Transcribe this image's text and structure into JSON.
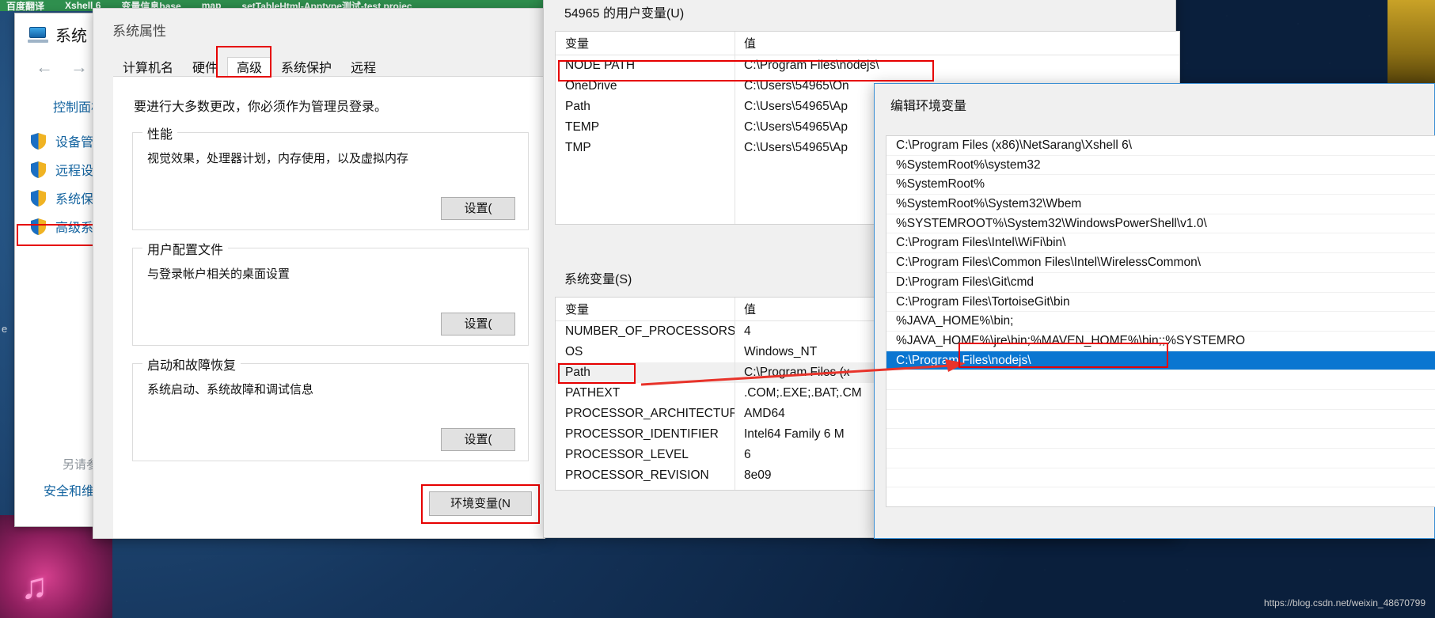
{
  "desktop": {
    "browser_tabs": [
      "百度翻译",
      "Xshell 6",
      "变量信息base",
      "map",
      "setTableHtml-Apptype测试-test projec"
    ],
    "stray_letter": "e"
  },
  "control_panel": {
    "title": "系统",
    "nav": {
      "back": "←",
      "forward": "→",
      "recent": "⌄",
      "up": "↑"
    },
    "home_link": "控制面板主页",
    "links": [
      {
        "label": "设备管理器"
      },
      {
        "label": "远程设置"
      },
      {
        "label": "系统保护"
      },
      {
        "label": "高级系统设置"
      }
    ],
    "see_also": "另请参阅",
    "security_link": "安全和维护"
  },
  "system_properties": {
    "title": "系统属性",
    "tabs": [
      {
        "label": "计算机名",
        "active": false
      },
      {
        "label": "硬件",
        "active": false
      },
      {
        "label": "高级",
        "active": true
      },
      {
        "label": "系统保护",
        "active": false
      },
      {
        "label": "远程",
        "active": false
      }
    ],
    "admin_notice": "要进行大多数更改，你必须作为管理员登录。",
    "groups": [
      {
        "legend": "性能",
        "description": "视觉效果，处理器计划，内存使用，以及虚拟内存",
        "button": "设置("
      },
      {
        "legend": "用户配置文件",
        "description": "与登录帐户相关的桌面设置",
        "button": "设置("
      },
      {
        "legend": "启动和故障恢复",
        "description": "系统启动、系统故障和调试信息",
        "button": "设置("
      }
    ],
    "env_button": "环境变量(N"
  },
  "environment_variables": {
    "user_section_label": "54965 的用户变量(U)",
    "system_section_label": "系统变量(S)",
    "columns": {
      "variable": "变量",
      "value": "值"
    },
    "user_variables": [
      {
        "name": "NODE PATH",
        "value": "C:\\Program Files\\nodejs\\",
        "highlighted": true
      },
      {
        "name": "OneDrive",
        "value": "C:\\Users\\54965\\On"
      },
      {
        "name": "Path",
        "value": "C:\\Users\\54965\\Ap"
      },
      {
        "name": "TEMP",
        "value": "C:\\Users\\54965\\Ap"
      },
      {
        "name": "TMP",
        "value": "C:\\Users\\54965\\Ap"
      }
    ],
    "system_variables": [
      {
        "name": "NUMBER_OF_PROCESSORS",
        "value": "4"
      },
      {
        "name": "OS",
        "value": "Windows_NT"
      },
      {
        "name": "Path",
        "value": "C:\\Program Files (x",
        "selected": true,
        "highlighted": true
      },
      {
        "name": "PATHEXT",
        "value": ".COM;.EXE;.BAT;.CM"
      },
      {
        "name": "PROCESSOR_ARCHITECTURE",
        "value": "AMD64"
      },
      {
        "name": "PROCESSOR_IDENTIFIER",
        "value": "Intel64 Family 6 M"
      },
      {
        "name": "PROCESSOR_LEVEL",
        "value": "6"
      },
      {
        "name": "PROCESSOR_REVISION",
        "value": "8e09"
      }
    ]
  },
  "edit_environment_variable": {
    "title": "编辑环境变量",
    "entries": [
      {
        "path": "C:\\Program Files (x86)\\NetSarang\\Xshell 6\\",
        "selected": false
      },
      {
        "path": "%SystemRoot%\\system32",
        "selected": false
      },
      {
        "path": "%SystemRoot%",
        "selected": false
      },
      {
        "path": "%SystemRoot%\\System32\\Wbem",
        "selected": false
      },
      {
        "path": "%SYSTEMROOT%\\System32\\WindowsPowerShell\\v1.0\\",
        "selected": false
      },
      {
        "path": "C:\\Program Files\\Intel\\WiFi\\bin\\",
        "selected": false
      },
      {
        "path": "C:\\Program Files\\Common Files\\Intel\\WirelessCommon\\",
        "selected": false
      },
      {
        "path": "D:\\Program Files\\Git\\cmd",
        "selected": false
      },
      {
        "path": "C:\\Program Files\\TortoiseGit\\bin",
        "selected": false
      },
      {
        "path": "%JAVA_HOME%\\bin;",
        "selected": false
      },
      {
        "path": "%JAVA_HOME%\\jre\\bin;%MAVEN_HOME%\\bin;;%SYSTEMRO",
        "selected": false
      },
      {
        "path": "C:\\Program Files\\nodejs\\",
        "selected": true
      }
    ]
  },
  "annotations": {
    "accent_color": "#e60000",
    "selection_color": "#0a76d1"
  },
  "watermark": "https://blog.csdn.net/weixin_48670799"
}
